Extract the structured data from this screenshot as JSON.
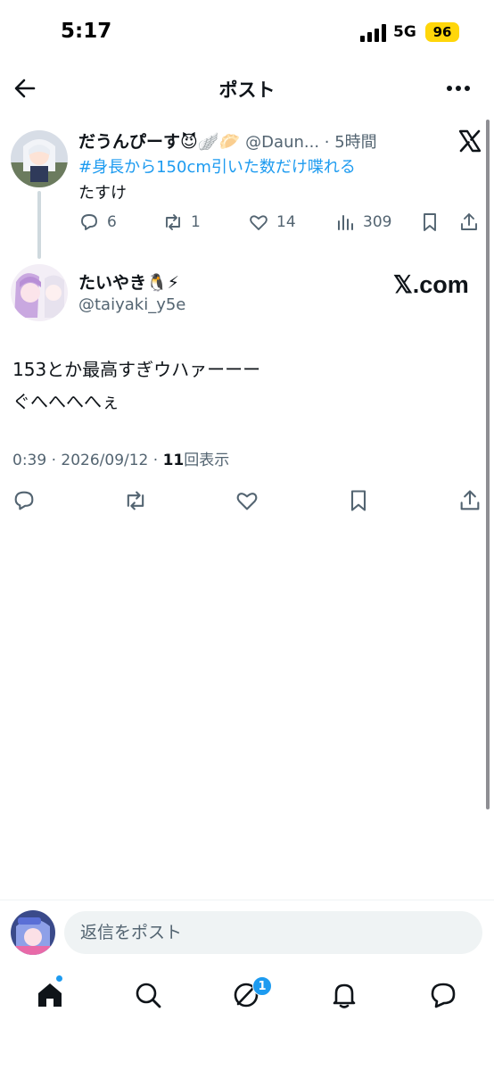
{
  "status_bar": {
    "time": "5:17",
    "network": "5G",
    "battery": "96",
    "battery_color": "#ffd60a"
  },
  "header": {
    "title": "ポスト",
    "back_icon": "arrow-left-icon",
    "more_icon": "ellipsis-icon"
  },
  "parent_post": {
    "display_name": "だうんぴーす😈🪽🥟",
    "handle_time": "@Daun... · 5時間",
    "hashtag": "#身長から150cm引いた数だけ喋れる",
    "text": "たすけ",
    "replies": "6",
    "reposts": "1",
    "likes": "14",
    "views": "309"
  },
  "main_post": {
    "display_name": "たいやき🐧⚡",
    "handle": "@taiyaki_y5e",
    "source_logo": "𝕏.com",
    "text_line1": "153とか最高すぎウハァーーー",
    "text_line2": "ぐへへへへぇ",
    "timestamp": "0:39 · 2026/09/12 · ",
    "view_count": "11",
    "view_label": "回表示"
  },
  "reply_bar": {
    "placeholder": "返信をポスト"
  },
  "bottom_nav": {
    "items": [
      "home-icon",
      "search-icon",
      "grok-icon",
      "notifications-icon",
      "messages-icon"
    ],
    "grok_badge": "1"
  },
  "colors": {
    "accent": "#1d9bf0",
    "text": "#0f1419",
    "secondary": "#536471"
  }
}
